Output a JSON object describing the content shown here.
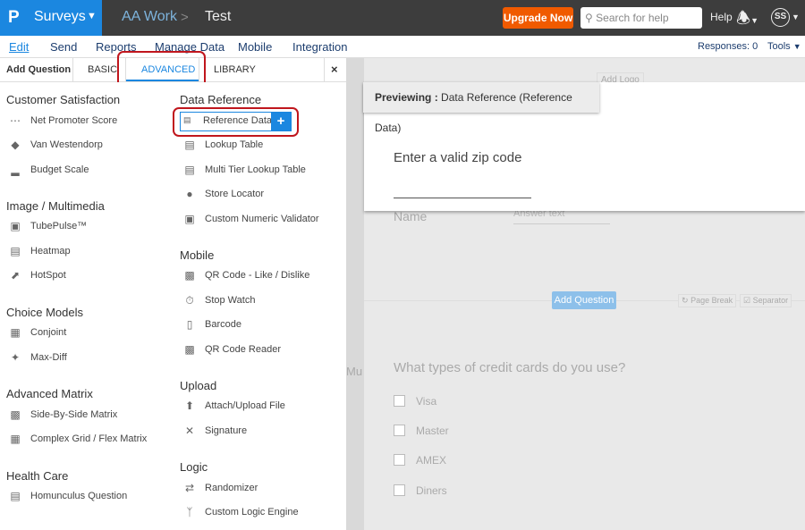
{
  "topbar": {
    "logo": "P",
    "app": "Surveys",
    "crumb1": "AA Work",
    "crumb_sep": ">",
    "crumb2": "Test",
    "upgrade": "Upgrade Now",
    "search_placeholder": "Search for help",
    "help": "Help",
    "avatar": "SS"
  },
  "nav": {
    "items": [
      "Edit",
      "Send",
      "Reports",
      "Manage Data",
      "Mobile",
      "Integration"
    ],
    "responses": "Responses: 0",
    "tools": "Tools"
  },
  "panel": {
    "title": "Add Question",
    "tabs": [
      "BASIC",
      "ADVANCED",
      "LIBRARY"
    ],
    "close": "×"
  },
  "left_sections": [
    {
      "title": "Customer Satisfaction",
      "items": [
        "Net Promoter Score",
        "Van Westendorp",
        "Budget Scale"
      ]
    },
    {
      "title": "Image / Multimedia",
      "items": [
        "TubePulse™",
        "Heatmap",
        "HotSpot"
      ]
    },
    {
      "title": "Choice Models",
      "items": [
        "Conjoint",
        "Max-Diff"
      ]
    },
    {
      "title": "Advanced Matrix",
      "items": [
        "Side-By-Side Matrix",
        "Complex Grid / Flex Matrix"
      ]
    },
    {
      "title": "Health Care",
      "items": [
        "Homunculus Question"
      ]
    }
  ],
  "right_sections": [
    {
      "title": "Data Reference",
      "items": [
        "Reference Data",
        "Lookup Table",
        "Multi Tier Lookup Table",
        "Store Locator",
        "Custom Numeric Validator"
      ]
    },
    {
      "title": "Mobile",
      "items": [
        "QR Code - Like / Dislike",
        "Stop Watch",
        "Barcode",
        "QR Code Reader"
      ]
    },
    {
      "title": "Upload",
      "items": [
        "Attach/Upload File",
        "Signature"
      ]
    },
    {
      "title": "Logic",
      "items": [
        "Randomizer",
        "Custom Logic Engine"
      ]
    }
  ],
  "canvas": {
    "add_logo": "Add Logo",
    "preview_label": "Previewing :",
    "preview_name": "Data Reference (Reference Data)",
    "preview_question": "Enter a valid zip code",
    "name_label": "Name",
    "answer_placeholder": "Answer text",
    "add_question": "Add Question",
    "page_break": "Page Break",
    "separator": "Separator",
    "mu": "Mu",
    "question2": "What types of credit cards do you use?",
    "options": [
      "Visa",
      "Master",
      "AMEX",
      "Diners"
    ]
  },
  "colors": {
    "brand": "#1b87e0",
    "upgrade": "#f05a00",
    "highlight": "#c0161d"
  }
}
